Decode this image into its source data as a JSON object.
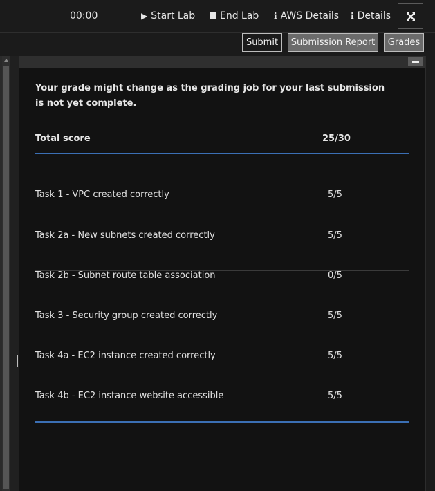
{
  "topbar": {
    "timer": "00:00",
    "start_lab": "Start Lab",
    "end_lab": "End Lab",
    "aws_details": "AWS Details",
    "details": "Details"
  },
  "actions": {
    "submit": "Submit",
    "submission_report": "Submission Report",
    "grades": "Grades"
  },
  "grades": {
    "notice": "Your grade might change as the grading job for your last submission is not yet complete.",
    "total_label": "Total score",
    "total_score": "25/30",
    "tasks": [
      {
        "label": "Task 1 - VPC created correctly",
        "score": "5/5"
      },
      {
        "label": "Task 2a - New subnets created correctly",
        "score": "5/5"
      },
      {
        "label": "Task 2b - Subnet route table association",
        "score": "0/5"
      },
      {
        "label": "Task 3 - Security group created correctly",
        "score": "5/5"
      },
      {
        "label": "Task 4a - EC2 instance created correctly",
        "score": "5/5"
      },
      {
        "label": "Task 4b - EC2 instance website accessible",
        "score": "5/5"
      }
    ]
  },
  "icons": {
    "start": "play-icon",
    "end": "stop-square-icon",
    "info": "info-icon",
    "expand": "expand-arrows-icon",
    "collapse": "minus-icon"
  },
  "colors": {
    "accent_line": "#3b6fb4",
    "panel_bg": "#121212",
    "page_bg": "#1b1b1b"
  }
}
